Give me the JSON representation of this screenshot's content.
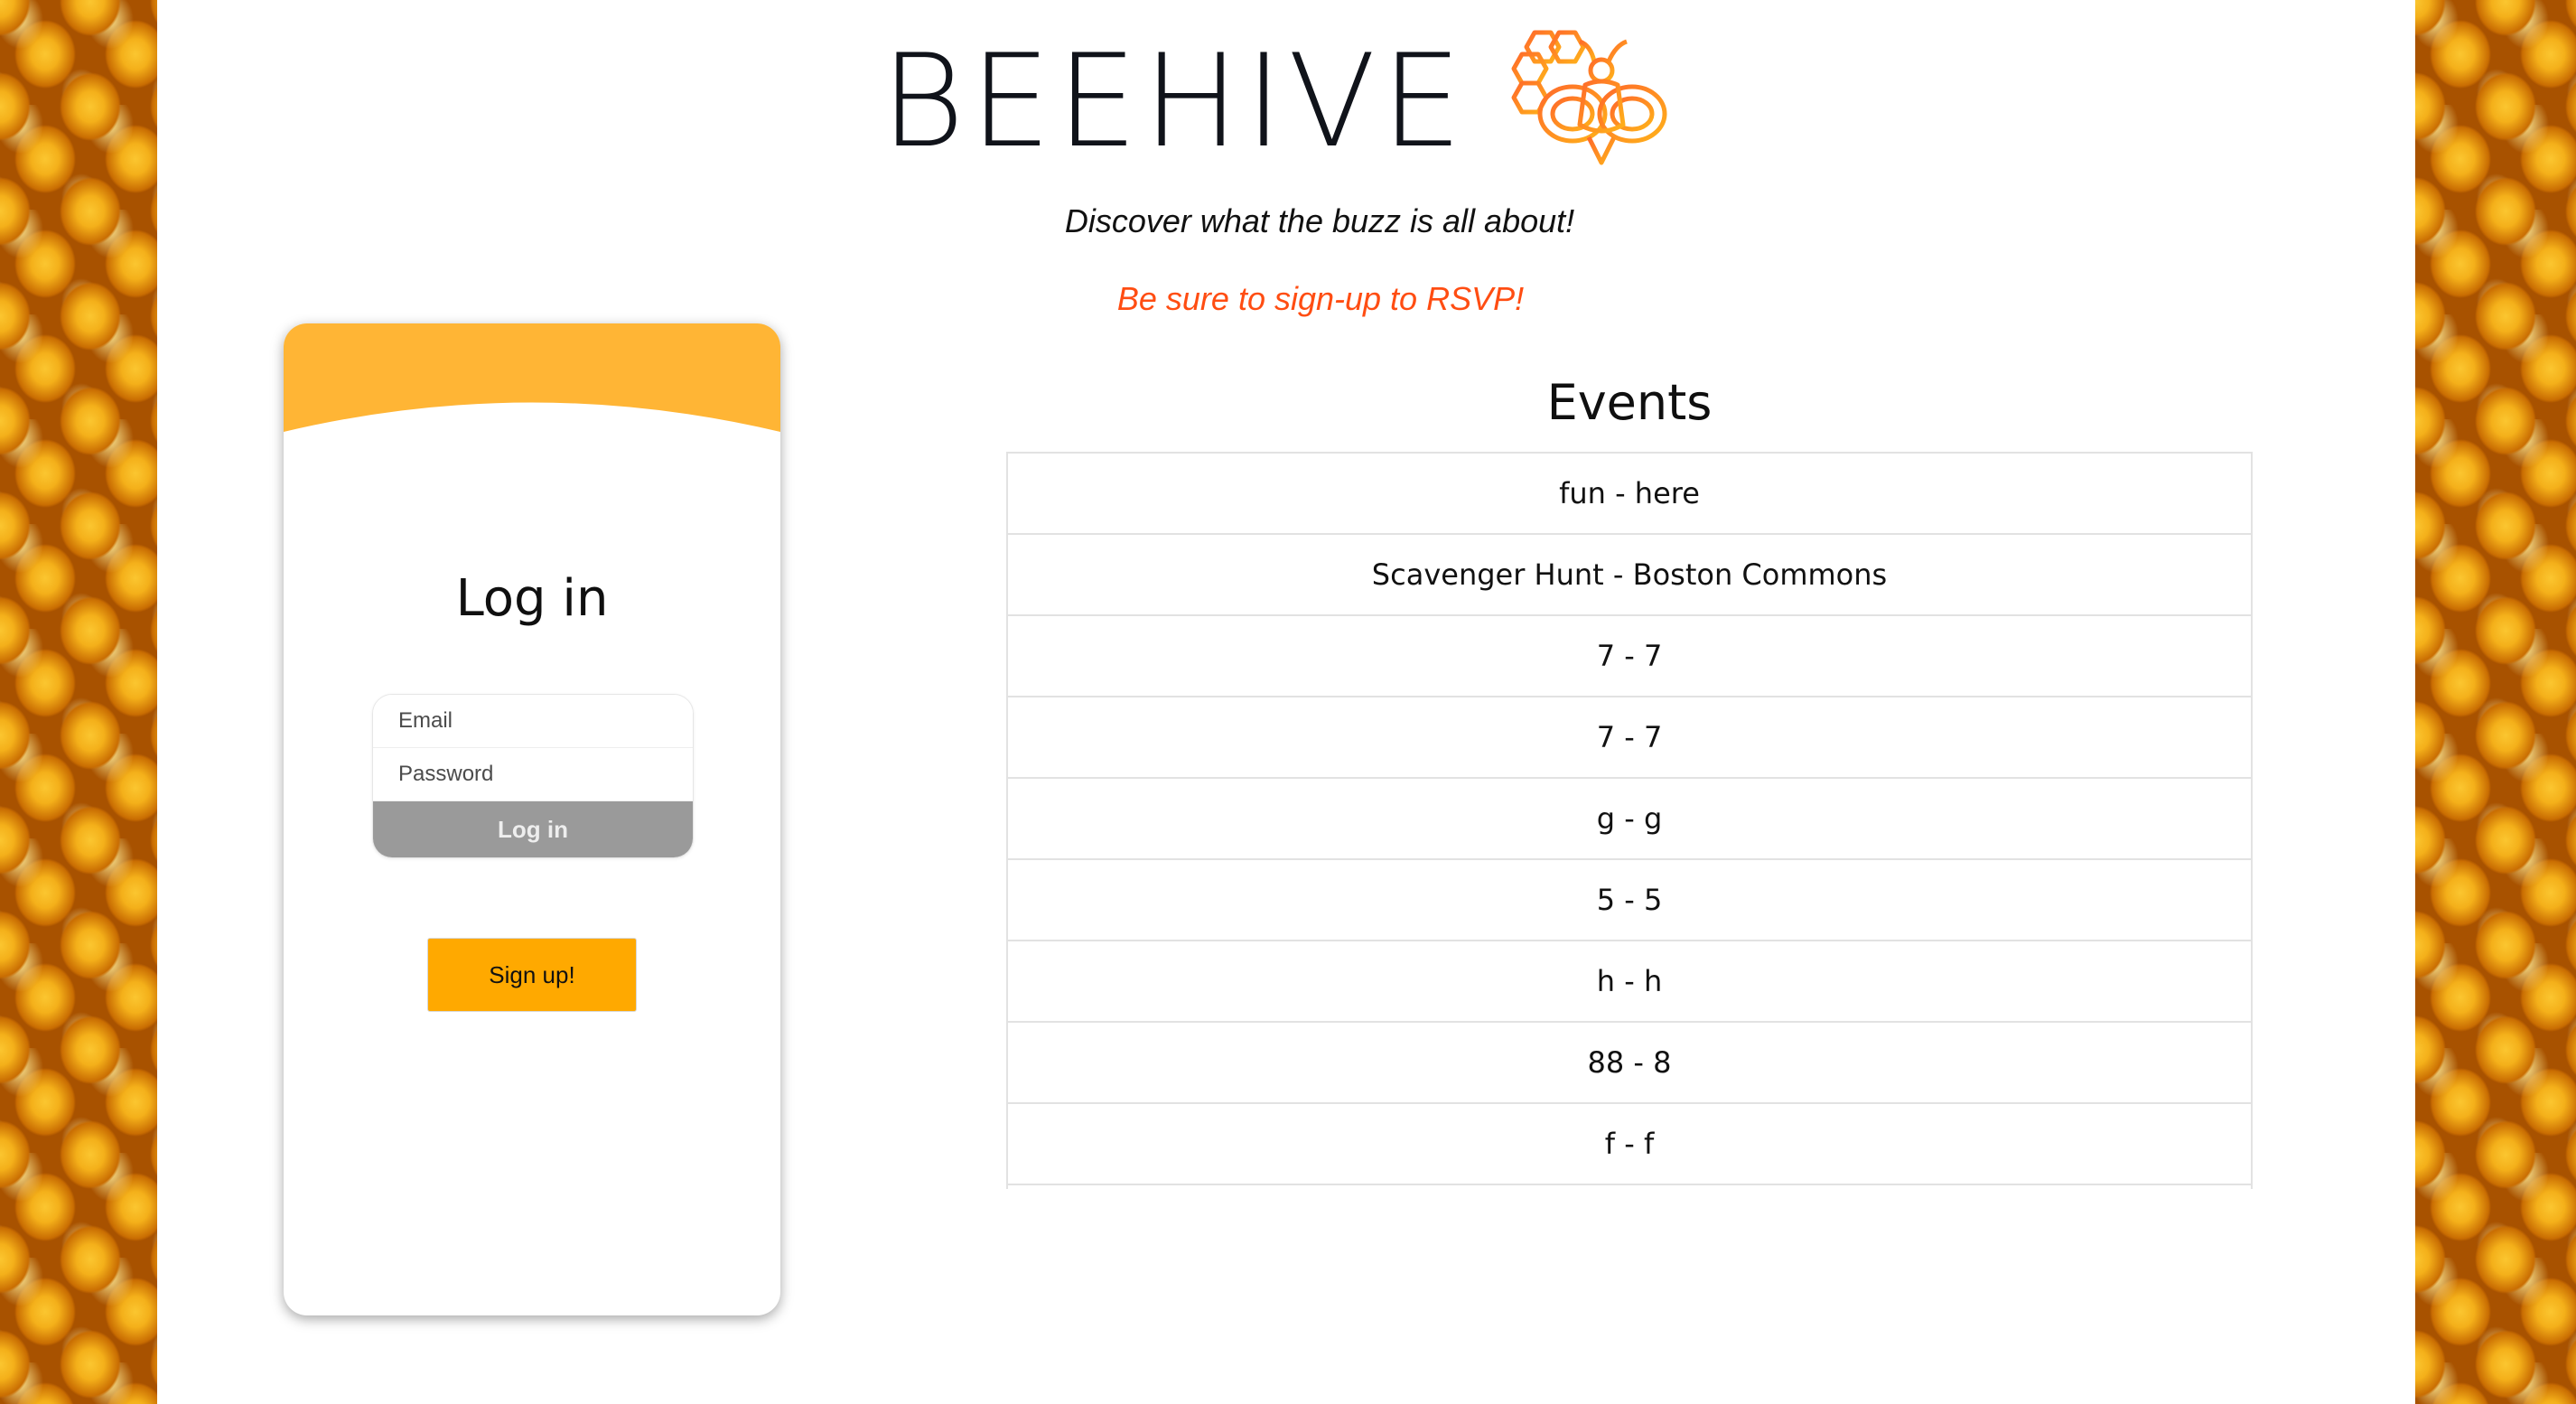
{
  "header": {
    "brand_title": "BEEHIVE",
    "logo_icon": "bee-honeycomb-logo",
    "tagline": "Discover what the buzz is all about!",
    "notice": "Be sure to sign-up to RSVP!"
  },
  "login": {
    "title": "Log in",
    "email_placeholder": "Email",
    "password_placeholder": "Password",
    "submit_label": "Log in",
    "signup_label": "Sign up!"
  },
  "events": {
    "title": "Events",
    "items": [
      "fun - here",
      "Scavenger Hunt - Boston Commons",
      "7 - 7",
      "7 - 7",
      "g - g",
      "5 - 5",
      "h - h",
      "88 - 8",
      "f - f"
    ]
  },
  "colors": {
    "accent_orange": "#ffa900",
    "card_header": "#ffb535",
    "notice_red": "#ff4d12",
    "logo_gradient_start": "#ff6a2a",
    "logo_gradient_end": "#ffb21a",
    "disabled_button": "#9a9a9a"
  }
}
